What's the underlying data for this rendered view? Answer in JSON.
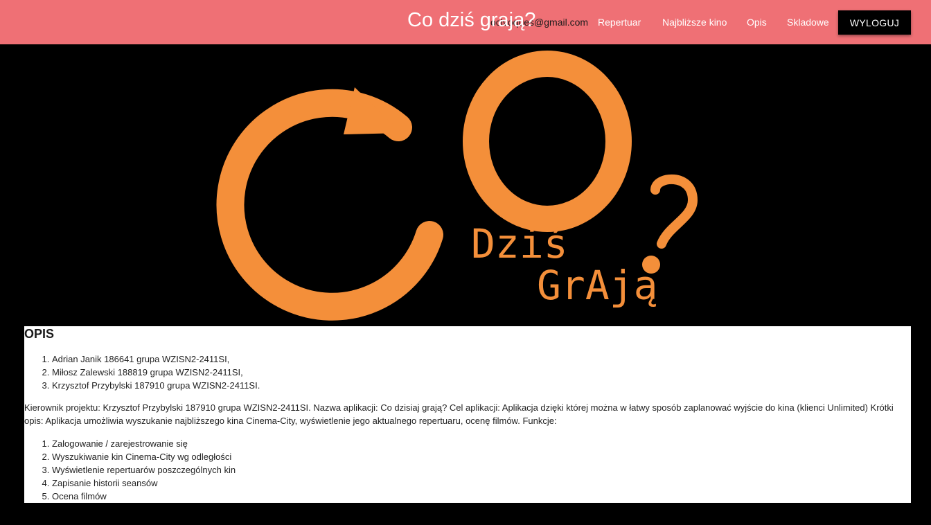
{
  "header": {
    "brand": "Co dziś grają?",
    "user_email": "oclvoques@gmail.com",
    "nav": [
      {
        "label": "Repertuar"
      },
      {
        "label": "Najbliższe kino"
      },
      {
        "label": "Opis"
      },
      {
        "label": "Skladowe"
      }
    ],
    "logout_label": "WYLOGUJ"
  },
  "hero": {
    "logo_text_line1": "Dziś",
    "logo_text_line2": "GrAją",
    "colors": {
      "logo": "#f48f3a",
      "background": "#000000"
    }
  },
  "content": {
    "heading": "OPIS",
    "members": [
      "Adrian Janik 186641 grupa WZISN2-2411SI,",
      "Miłosz Zalewski 188819 grupa WZISN2-2411SI,",
      "Krzysztof Przybylski 187910 grupa WZISN2-2411SI."
    ],
    "description": "Kierownik projektu: Krzysztof Przybylski 187910 grupa WZISN2-2411SI. Nazwa aplikacji: Co dzisiaj grają? Cel aplikacji: Aplikacja dzięki której można w łatwy sposób zaplanować wyjście do kina (klienci Unlimited) Krótki opis: Aplikacja umożliwia wyszukanie najbliższego kina Cinema-City, wyświetlenie jego aktualnego repertuaru, ocenę filmów. Funkcje:",
    "functions": [
      "Zalogowanie / zarejestrowanie się",
      "Wyszukiwanie kin Cinema-City wg odległości",
      "Wyświetlenie repertuarów poszczególnych kin",
      "Zapisanie historii seansów",
      "Ocena filmów"
    ]
  },
  "colors": {
    "header_bg": "#ef7075",
    "button_bg": "#000000",
    "accent": "#f48f3a"
  }
}
